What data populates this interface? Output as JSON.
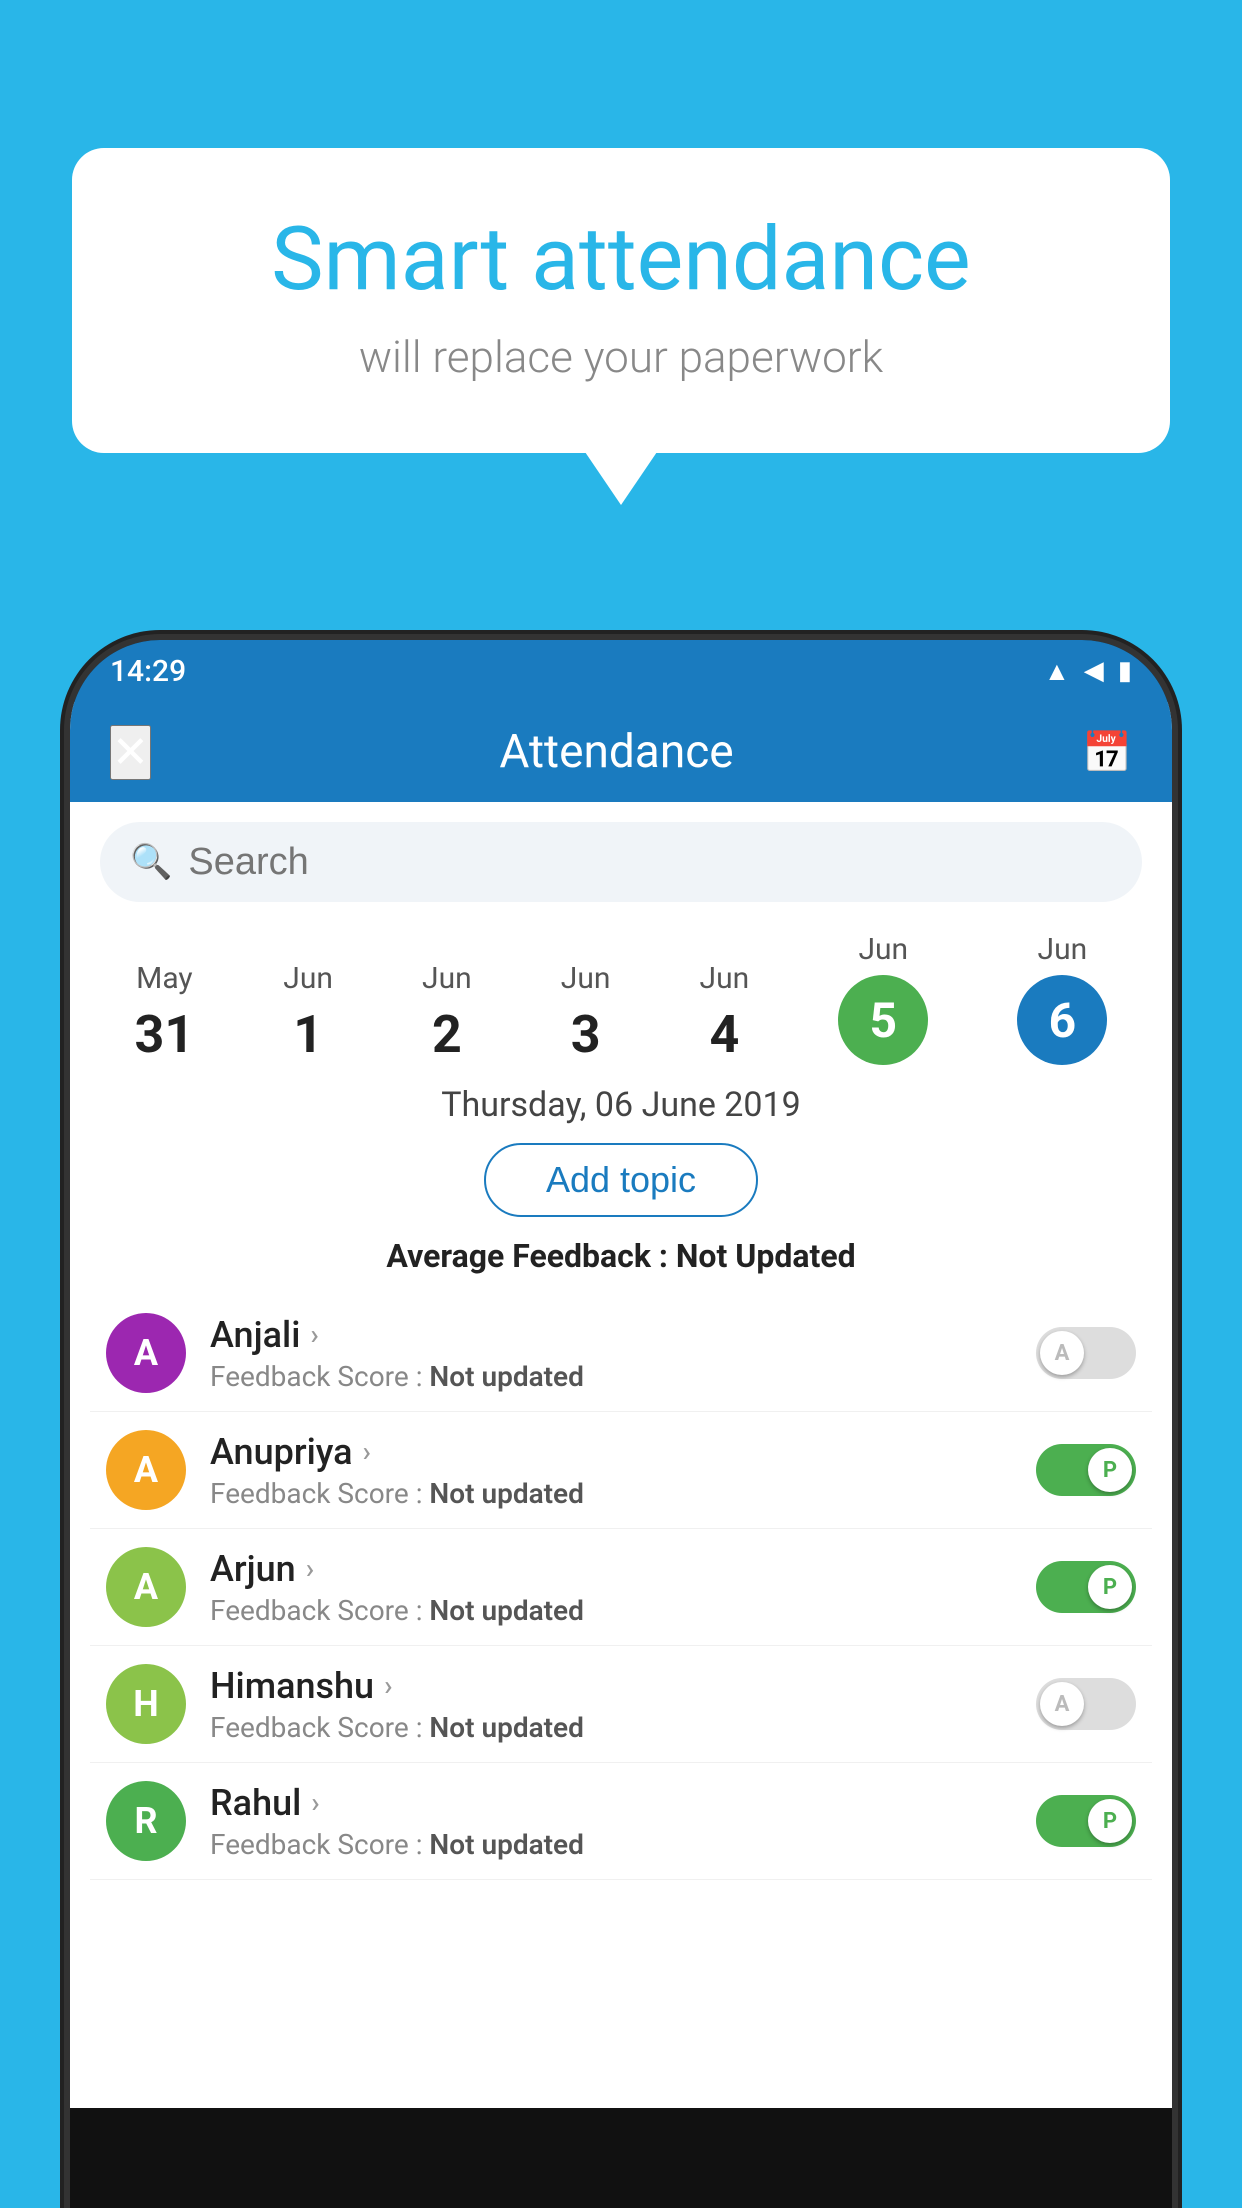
{
  "background_color": "#29b6e8",
  "speech_bubble": {
    "heading": "Smart attendance",
    "subtext": "will replace your paperwork"
  },
  "app": {
    "header": {
      "title": "Attendance",
      "close_label": "✕",
      "calendar_icon": "📅"
    },
    "search": {
      "placeholder": "Search"
    },
    "dates": [
      {
        "month": "May",
        "day": "31",
        "selected": false
      },
      {
        "month": "Jun",
        "day": "1",
        "selected": false
      },
      {
        "month": "Jun",
        "day": "2",
        "selected": false
      },
      {
        "month": "Jun",
        "day": "3",
        "selected": false
      },
      {
        "month": "Jun",
        "day": "4",
        "selected": false
      },
      {
        "month": "Jun",
        "day": "5",
        "selected": "green"
      },
      {
        "month": "Jun",
        "day": "6",
        "selected": "blue"
      }
    ],
    "selected_date_label": "Thursday, 06 June 2019",
    "add_topic_label": "Add topic",
    "avg_feedback_label": "Average Feedback :",
    "avg_feedback_value": "Not Updated",
    "students": [
      {
        "name": "Anjali",
        "avatar_letter": "A",
        "avatar_color": "#9c27b0",
        "feedback_label": "Feedback Score :",
        "feedback_value": "Not updated",
        "toggle": "off",
        "toggle_letter": "A"
      },
      {
        "name": "Anupriya",
        "avatar_letter": "A",
        "avatar_color": "#f5a623",
        "feedback_label": "Feedback Score :",
        "feedback_value": "Not updated",
        "toggle": "on",
        "toggle_letter": "P"
      },
      {
        "name": "Arjun",
        "avatar_letter": "A",
        "avatar_color": "#8bc34a",
        "feedback_label": "Feedback Score :",
        "feedback_value": "Not updated",
        "toggle": "on",
        "toggle_letter": "P"
      },
      {
        "name": "Himanshu",
        "avatar_letter": "H",
        "avatar_color": "#8bc34a",
        "feedback_label": "Feedback Score :",
        "feedback_value": "Not updated",
        "toggle": "off",
        "toggle_letter": "A"
      },
      {
        "name": "Rahul",
        "avatar_letter": "R",
        "avatar_color": "#4caf50",
        "feedback_label": "Feedback Score :",
        "feedback_value": "Not updated",
        "toggle": "on",
        "toggle_letter": "P"
      }
    ],
    "status_bar": {
      "time": "14:29"
    }
  }
}
